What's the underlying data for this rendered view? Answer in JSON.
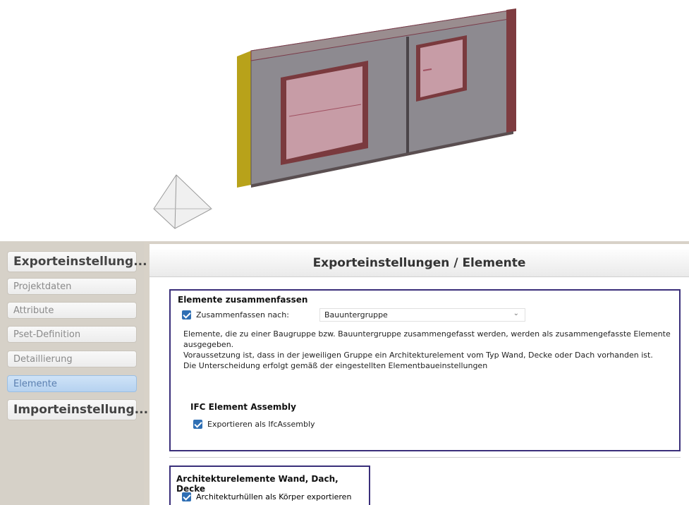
{
  "viewport": {
    "model_description_icon": "wall-panel-3d-model",
    "view_cube_icon": "pyramid-view-icon"
  },
  "sidebar": {
    "items": [
      {
        "label": "Exporteinstellung...",
        "type": "major"
      },
      {
        "label": "Projektdaten",
        "type": "sub"
      },
      {
        "label": "Attribute",
        "type": "sub"
      },
      {
        "label": "Pset-Definition",
        "type": "sub"
      },
      {
        "label": "Detaillierung",
        "type": "sub"
      },
      {
        "label": "Elemente",
        "type": "sub",
        "active": true
      },
      {
        "label": "Importeinstellung...",
        "type": "major"
      }
    ]
  },
  "main": {
    "title": "Exporteinstellungen / Elemente",
    "group1": {
      "title": "Elemente zusammenfassen",
      "checkbox_label": "Zusammenfassen nach:",
      "checkbox_checked": true,
      "select_value": "Bauuntergruppe",
      "description": [
        "Elemente, die zu einer Baugruppe bzw. Bauuntergruppe zusammengefasst werden, werden als zusammengefasste Elemente ausgegeben.",
        "Voraussetzung ist, dass in der jeweiligen Gruppe ein  Architekturelement vom Typ Wand, Decke oder Dach vorhanden ist.",
        "Die Unterscheidung erfolgt gemäß der eingestellten Elementbaueinstellungen"
      ],
      "sub_title": "IFC Element Assembly",
      "sub_checkbox_label": "Exportieren als IfcAssembly",
      "sub_checkbox_checked": true
    },
    "group2": {
      "title": "Architekturelemente Wand, Dach, Decke",
      "checkbox_label": "Architekturhüllen als Körper exportieren",
      "checkbox_checked": true
    }
  },
  "colors": {
    "accent_border": "#3a2f7a",
    "checkbox": "#2f6fb4",
    "active_nav": "#b6d2f0"
  }
}
